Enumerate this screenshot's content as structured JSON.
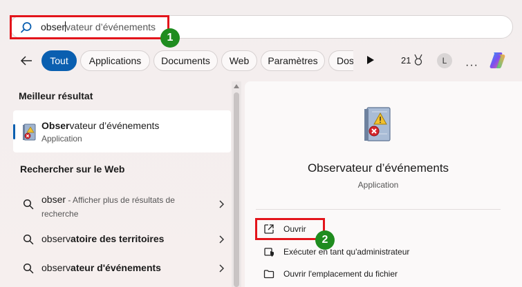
{
  "search": {
    "typed": "obser",
    "suggestion": "vateur d’événements"
  },
  "annotations": {
    "step1": "1",
    "step2": "2"
  },
  "filters": {
    "tout": "Tout",
    "applications": "Applications",
    "documents": "Documents",
    "web": "Web",
    "parametres": "Paramètres",
    "dossiers_truncated": "Dos"
  },
  "header": {
    "score": "21",
    "avatar_initial": "L",
    "more": "···"
  },
  "left": {
    "best_section_title": "Meilleur résultat",
    "best": {
      "title_bold": "Obser",
      "title_rest": "vateur d’événements",
      "subtitle": "Application"
    },
    "web_section_title": "Rechercher sur le Web",
    "web_results": [
      {
        "query": "obser",
        "description": " - Afficher plus de résultats de recherche"
      },
      {
        "bold": "observ",
        "rest": "atoire des territoires"
      },
      {
        "bold": "observ",
        "rest": "ateur d'événements"
      }
    ]
  },
  "right": {
    "title": "Observateur d’événements",
    "subtitle": "Application",
    "actions": [
      {
        "label": "Ouvrir"
      },
      {
        "label": "Exécuter en tant qu'administrateur"
      },
      {
        "label": "Ouvrir l'emplacement du fichier"
      }
    ]
  },
  "colors": {
    "accent": "#0a5fb0",
    "highlight": "#e3141b",
    "badge": "#1f8c1f"
  },
  "icons": {
    "search": "search-icon",
    "back": "back-arrow-icon",
    "play": "play-icon",
    "medal": "medal-icon",
    "copilot": "copilot-icon",
    "event_viewer": "event-viewer-icon",
    "open": "open-external-icon",
    "admin": "shield-icon",
    "folder": "folder-icon",
    "chevron": "chevron-right-icon"
  }
}
